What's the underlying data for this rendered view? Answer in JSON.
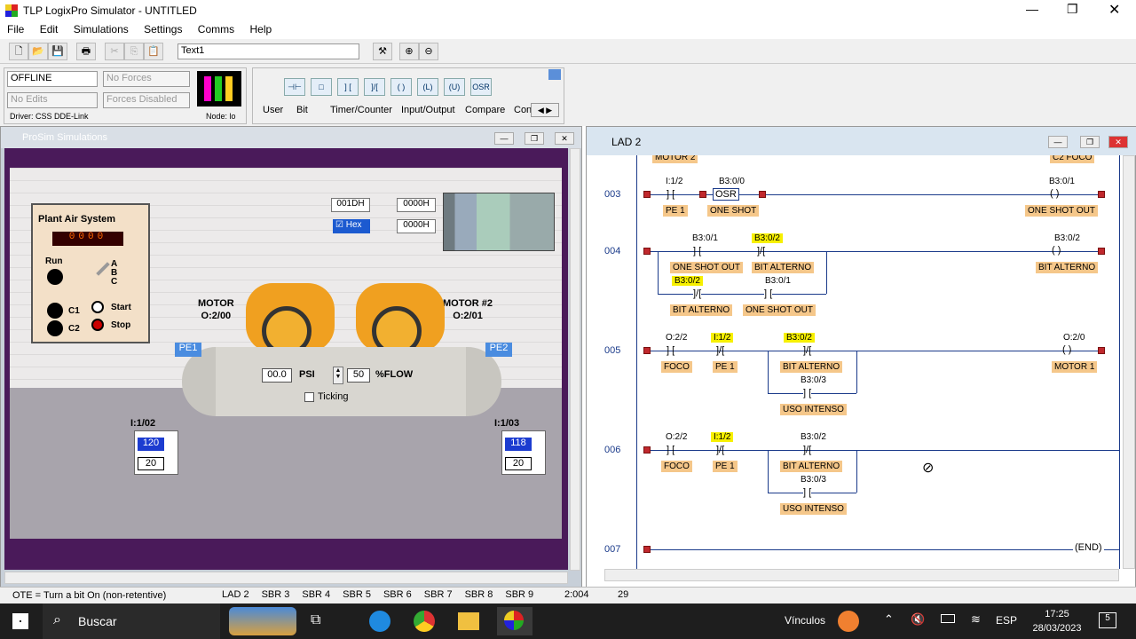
{
  "window": {
    "title": "TLP LogixPro Simulator  -  UNTITLED"
  },
  "menu": [
    "File",
    "Edit",
    "Simulations",
    "Settings",
    "Comms",
    "Help"
  ],
  "toolbar": {
    "text_field": "Text1"
  },
  "status_panel": {
    "mode": "OFFLINE",
    "forces": "No Forces",
    "edits": "No Edits",
    "forces_state": "Forces Disabled",
    "driver": "Driver: CSS DDE-Link",
    "node": "Node: lo"
  },
  "instr_buttons": [
    "⊣⊢",
    "□",
    "] [",
    "]/[",
    "( )",
    "(L)",
    "(U)",
    "OSR"
  ],
  "instr_tabs": [
    "User",
    "Bit",
    "Timer/Counter",
    "Input/Output",
    "Compare",
    "Con"
  ],
  "prosim": {
    "title": "ProSim Simulations",
    "plant_panel": {
      "title": "Plant Air System",
      "counter": [
        "0",
        "0",
        "0",
        "0"
      ],
      "run": "Run",
      "abc": [
        "A",
        "B",
        "C"
      ],
      "c1": "C1",
      "c2": "C2",
      "start": "Start",
      "stop": "Stop"
    },
    "motor1": {
      "name": "MOTOR",
      "addr": "O:2/00"
    },
    "motor2": {
      "name": "MOTOR #2",
      "addr": "O:2/01"
    },
    "disp": {
      "a_val": "001DH",
      "b_val": "0000H",
      "c_val": "0000H",
      "hex_label": "Hex"
    },
    "tank": {
      "psi_val": "00.0",
      "psi": "PSI",
      "flow_val": "50",
      "flow": "%FLOW",
      "ticking": "Ticking"
    },
    "pe1": "PE1",
    "pe2": "PE2",
    "i102": {
      "label": "I:1/02",
      "v1": "120",
      "v2": "20"
    },
    "i103": {
      "label": "I:1/03",
      "v1": "118",
      "v2": "20"
    }
  },
  "lad": {
    "title": "LAD 2",
    "top_partial": {
      "left": "MOTOR 2",
      "right": "C2 FOCO"
    },
    "rungs": [
      "003",
      "004",
      "005",
      "006",
      "007"
    ],
    "r003": {
      "c1_addr": "I:1/2",
      "c1_lbl": "PE 1",
      "c2_addr": "B3:0/0",
      "c2_lbl": "ONE SHOT",
      "osr": "OSR",
      "out_addr": "B3:0/1",
      "out_lbl": "ONE SHOT OUT"
    },
    "r004": {
      "a1": "B3:0/1",
      "l1": "ONE SHOT OUT",
      "a2": "B3:0/2",
      "l2": "BIT ALTERNO",
      "a3": "B3:0/2",
      "l3": "BIT ALTERNO",
      "a4": "B3:0/1",
      "l4": "ONE SHOT OUT",
      "out_addr": "B3:0/2",
      "out_lbl": "BIT ALTERNO"
    },
    "r005": {
      "a1": "O:2/2",
      "l1": "FOCO",
      "a2": "I:1/2",
      "l2": "PE 1",
      "a3": "B3:0/2",
      "l3": "BIT ALTERNO",
      "a4": "B3:0/3",
      "l4": "USO INTENSO",
      "out_addr": "O:2/0",
      "out_lbl": "MOTOR 1"
    },
    "r006": {
      "a1": "O:2/2",
      "l1": "FOCO",
      "a2": "I:1/2",
      "l2": "PE 1",
      "a3": "B3:0/2",
      "l3": "BIT ALTERNO",
      "a4": "B3:0/3",
      "l4": "USO INTENSO"
    },
    "r007": {
      "end": "END"
    }
  },
  "status": {
    "hint": "OTE = Turn a bit On (non-retentive)",
    "tabs": [
      "LAD 2",
      "SBR 3",
      "SBR 4",
      "SBR 5",
      "SBR 6",
      "SBR 7",
      "SBR 8",
      "SBR 9"
    ],
    "pos": "2:004",
    "count": "29"
  },
  "taskbar": {
    "search": "Buscar",
    "links": "Vínculos",
    "lang": "ESP",
    "time": "17:25",
    "date": "28/03/2023",
    "notif": "5"
  },
  "colors": {
    "rung": "#1a3a8a",
    "contact_label": "#f5c78a",
    "highlight": "#f7f000",
    "node": "#c0282d"
  }
}
